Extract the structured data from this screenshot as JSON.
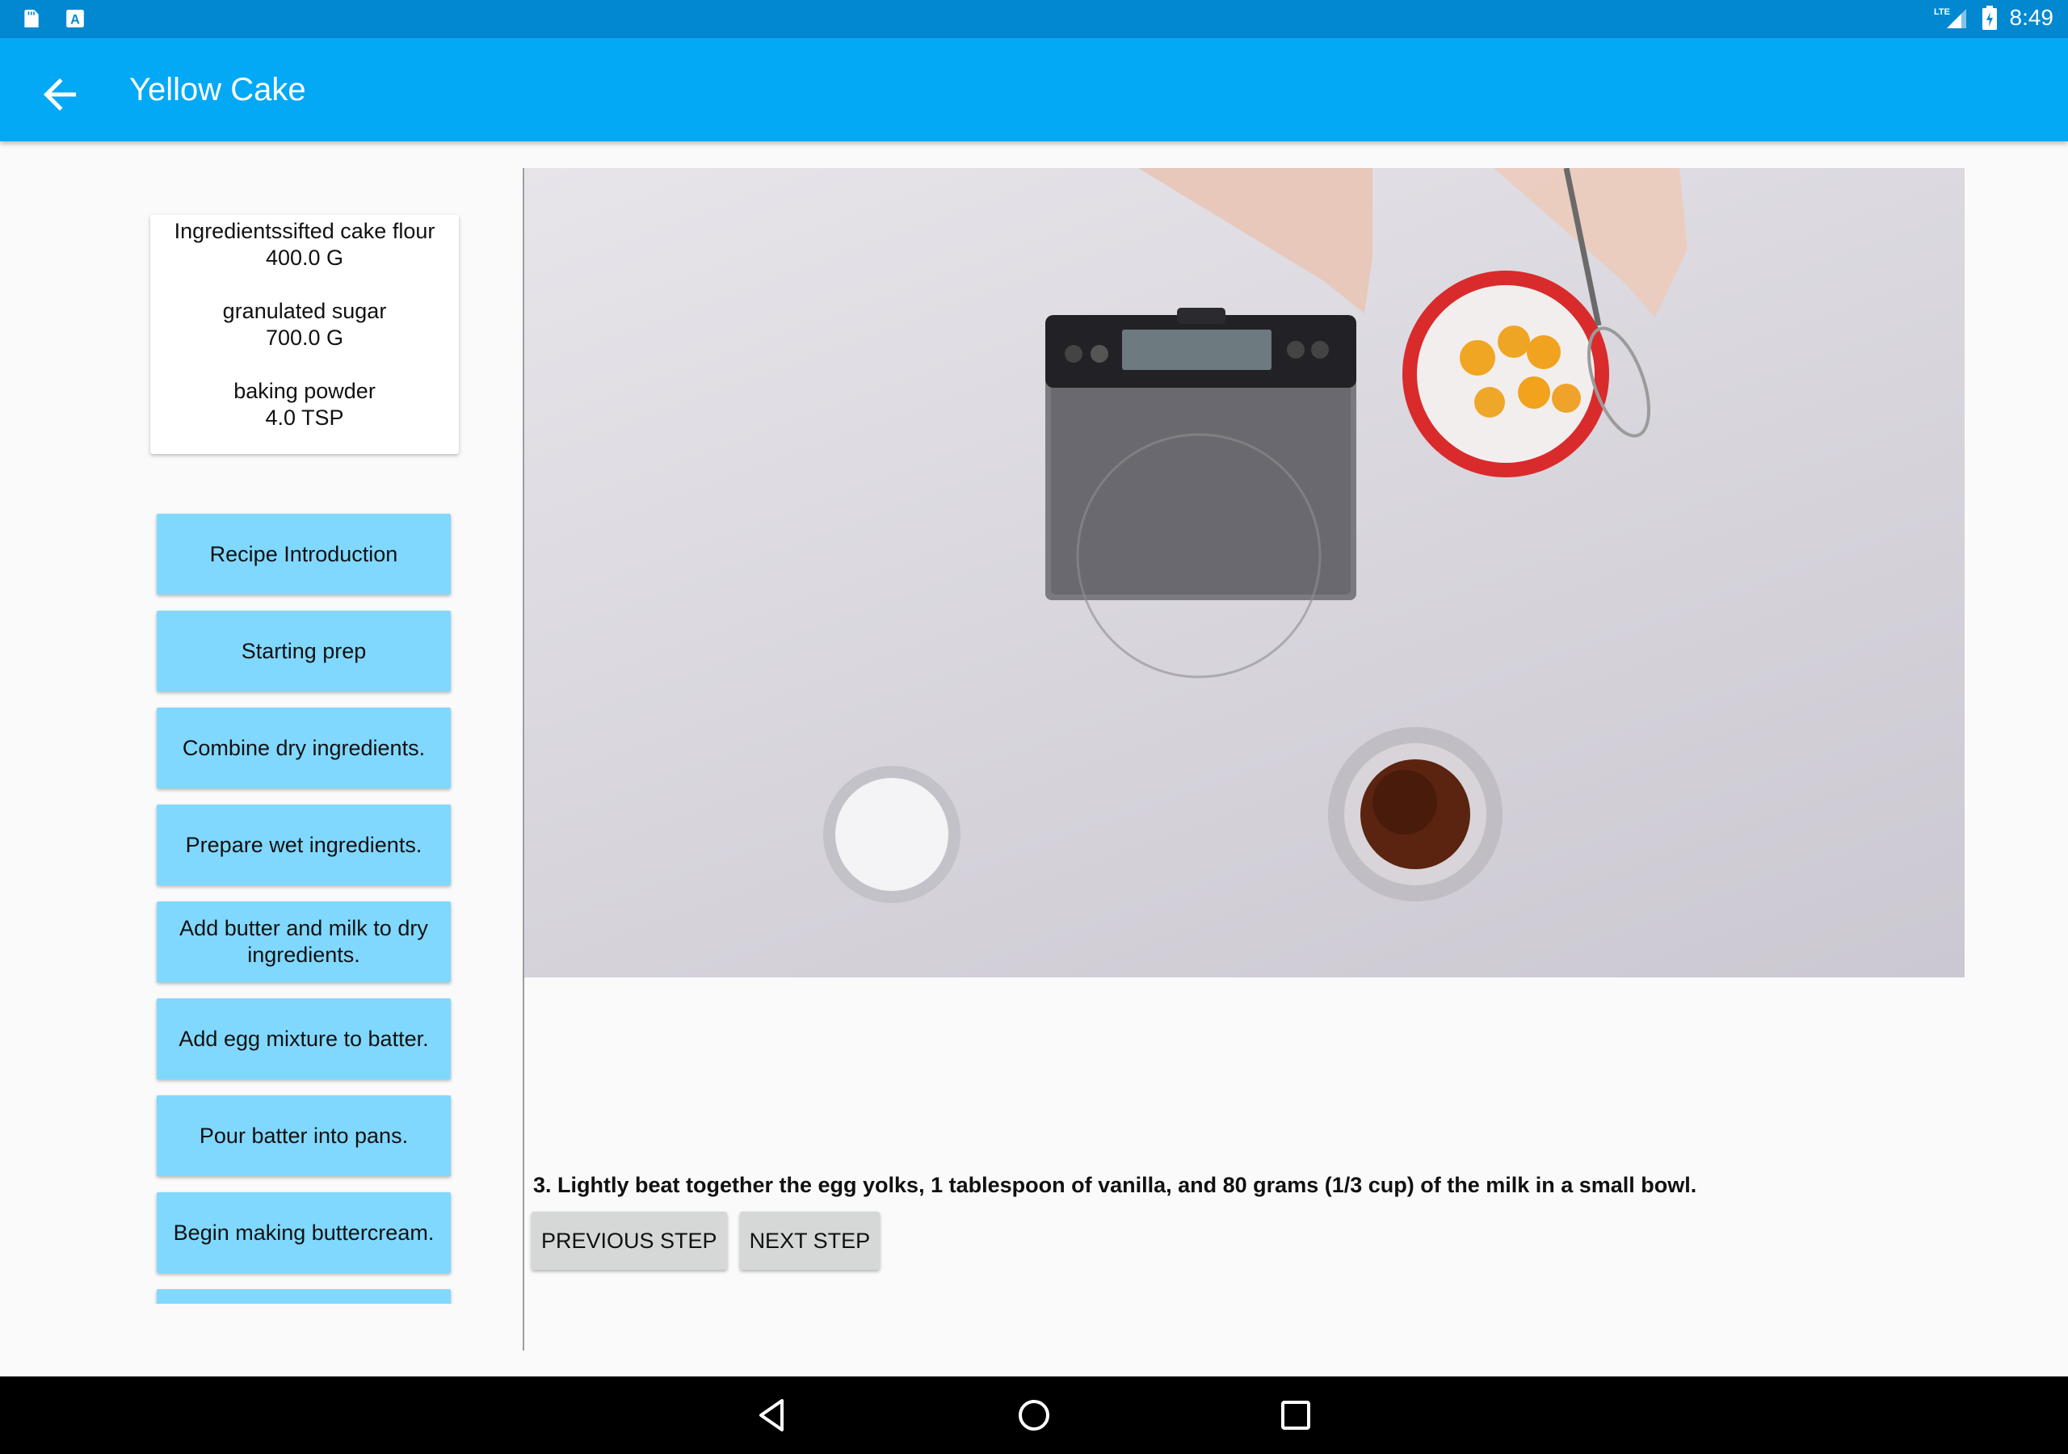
{
  "status_bar": {
    "time": "8:49",
    "network": "LTE",
    "icons": [
      "sd-card-icon",
      "text-a-icon",
      "signal-icon",
      "battery-icon"
    ]
  },
  "toolbar": {
    "title": "Yellow Cake",
    "back_icon": "arrow-back-icon"
  },
  "ingredients": {
    "items": [
      {
        "name": "Ingredientssifted cake flour",
        "amount": "400.0 G"
      },
      {
        "name": "granulated sugar",
        "amount": "700.0 G"
      },
      {
        "name": "baking powder",
        "amount": "4.0 TSP"
      }
    ]
  },
  "steps": [
    "Recipe Introduction",
    "Starting prep",
    "Combine dry ingredients.",
    "Prepare wet ingredients.",
    "Add butter and milk to dry ingredients.",
    "Add egg mixture to batter.",
    "Pour batter into pans.",
    "Begin making buttercream.",
    ""
  ],
  "player": {
    "instruction": "3. Lightly beat together the egg yolks, 1 tablespoon of vanilla, and 80 grams (1/3 cup) of the milk in a small bowl.",
    "previous_label": "PREVIOUS STEP",
    "next_label": "NEXT STEP"
  },
  "nav_bar": {
    "icons": [
      "back-triangle-icon",
      "home-circle-icon",
      "recents-square-icon"
    ]
  },
  "colors": {
    "status_bar": "#0288d1",
    "toolbar": "#03a9f4",
    "step_button": "#80d8ff",
    "nav_button": "#d6d7d7"
  }
}
